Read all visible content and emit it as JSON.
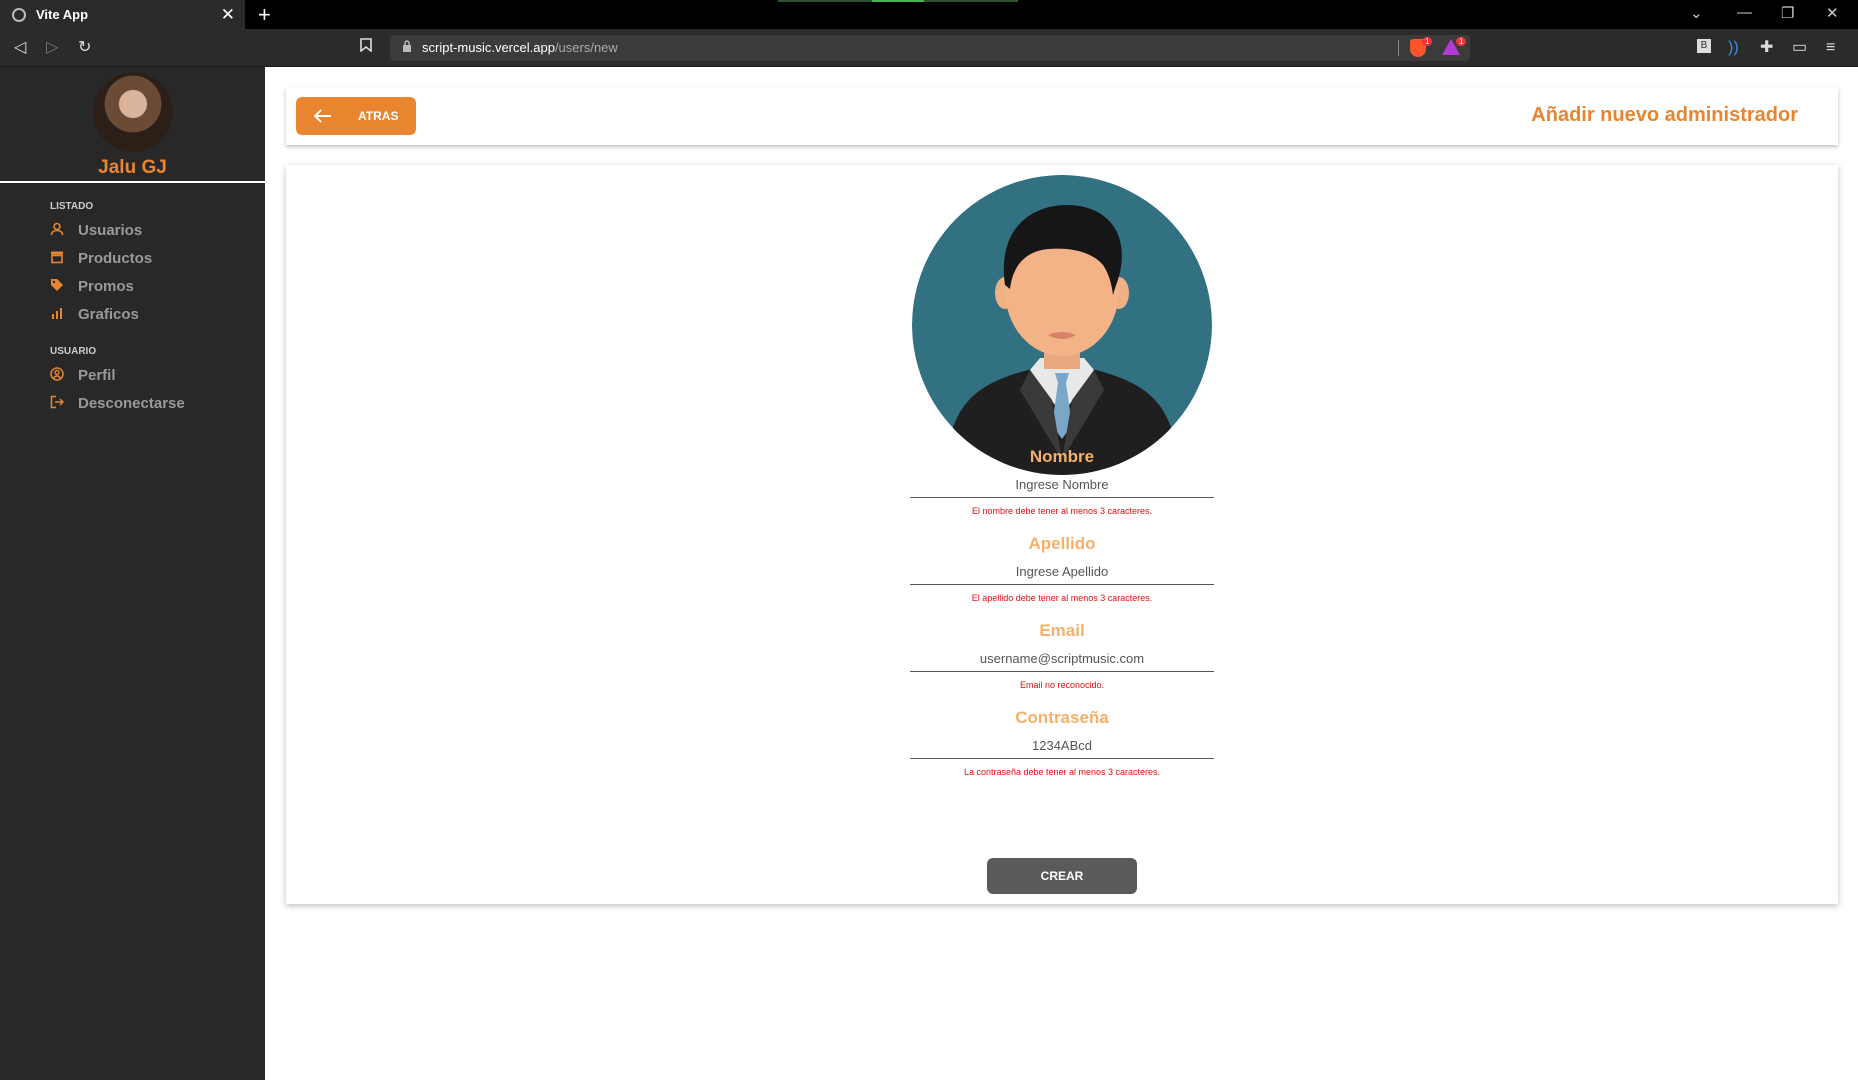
{
  "browser": {
    "tab_title": "Vite App",
    "tab_close": "✕",
    "new_tab": "+",
    "url_host": "script-music.vercel.app",
    "url_path": "/users/new",
    "shield_count": "1",
    "rewards_count": "1",
    "ext_label": "B"
  },
  "sidebar": {
    "user_name": "Jalu GJ",
    "section_listado": "LISTADO",
    "section_usuario": "USUARIO",
    "items": [
      {
        "label": "Usuarios",
        "icon": "user-icon"
      },
      {
        "label": "Productos",
        "icon": "store-icon"
      },
      {
        "label": "Promos",
        "icon": "tag-icon"
      },
      {
        "label": "Graficos",
        "icon": "bar-chart-icon"
      },
      {
        "label": "Perfil",
        "icon": "profile-icon"
      },
      {
        "label": "Desconectarse",
        "icon": "logout-icon"
      }
    ]
  },
  "header": {
    "back_label": "ATRAS",
    "title": "Añadir nuevo administrador"
  },
  "form": {
    "fields": [
      {
        "label": "Nombre",
        "placeholder": "Ingrese Nombre",
        "error": "El nombre debe tener al menos 3 caracteres."
      },
      {
        "label": "Apellido",
        "placeholder": "Ingrese Apellido",
        "error": "El apellido debe tener al menos 3 caracteres."
      },
      {
        "label": "Email",
        "placeholder": "username@scriptmusic.com",
        "error": "Email no reconocido."
      },
      {
        "label": "Contraseña",
        "placeholder": "1234ABcd",
        "error": "La contraseña debe tener al menos 3 caracteres."
      }
    ],
    "submit_label": "CREAR"
  },
  "colors": {
    "accent": "#e8852e",
    "label": "#f6b06a",
    "error": "#e01010",
    "sidebar_bg": "#282828"
  }
}
